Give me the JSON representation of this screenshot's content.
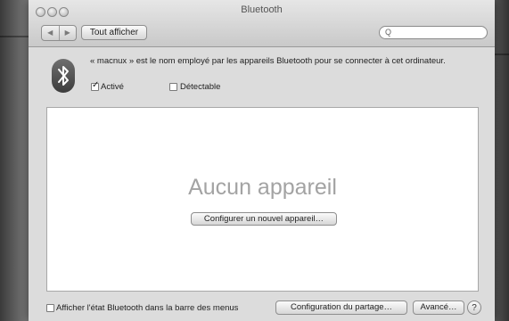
{
  "window": {
    "title": "Bluetooth"
  },
  "toolbar": {
    "back_glyph": "◀",
    "forward_glyph": "▶",
    "show_all_label": "Tout afficher",
    "search_icon": "search-icon",
    "search_glyph": "Q",
    "search_value": ""
  },
  "info": {
    "bluetooth_icon": "bluetooth-icon",
    "description": "« macnux » est le nom employé par les appareils Bluetooth pour se connecter à cet ordinateur.",
    "active_label": "Activé",
    "active_checked": true,
    "discoverable_label": "Détectable",
    "discoverable_checked": false
  },
  "device_list": {
    "empty_text": "Aucun appareil",
    "setup_button_label": "Configurer un nouvel appareil…"
  },
  "footer": {
    "menu_status_label": "Afficher l'état Bluetooth dans la barre des menus",
    "menu_status_checked": false,
    "sharing_button_label": "Configuration du partage…",
    "advanced_button_label": "Avancé…",
    "help_glyph": "?"
  }
}
